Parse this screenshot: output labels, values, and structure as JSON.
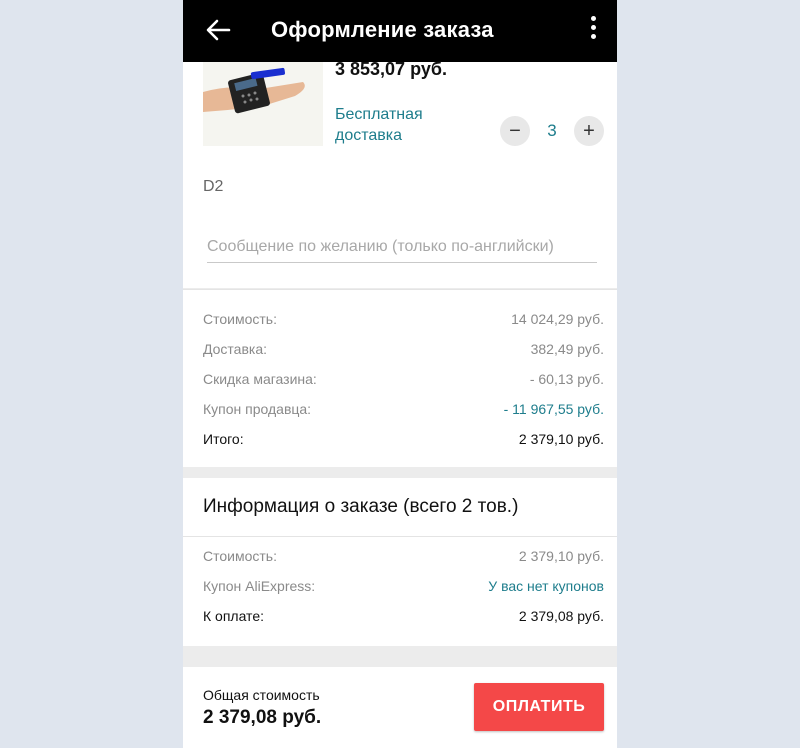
{
  "appbar": {
    "title": "Оформление заказа",
    "back_icon": "arrow-left-icon",
    "more_icon": "more-vertical-icon"
  },
  "product": {
    "price": "3 853,07 руб.",
    "shipping_line1": "Бесплатная",
    "shipping_line2": "доставка",
    "quantity": "3",
    "minus_label": "−",
    "plus_label": "+",
    "variant": "D2",
    "message_placeholder": "Сообщение по желанию (только по-английски)"
  },
  "summary": {
    "rows": [
      {
        "label": "Стоимость:",
        "value": "14 024,29 руб."
      },
      {
        "label": "Доставка:",
        "value": "382,49 руб."
      },
      {
        "label": "Скидка магазина:",
        "value": "- 60,13 руб."
      },
      {
        "label": "Купон продавца:",
        "value": "- 11 967,55 руб."
      },
      {
        "label": "Итого:",
        "value": "2 379,10 руб."
      }
    ]
  },
  "order_info": {
    "heading": "Информация о заказе (всего 2 тов.)",
    "rows": [
      {
        "label": "Стоимость:",
        "value": "2 379,10 руб."
      },
      {
        "label": "Купон AliExpress:",
        "value": "У вас нет купонов"
      },
      {
        "label": "К оплате:",
        "value": "2 379,08 руб."
      }
    ]
  },
  "bottom": {
    "caption": "Общая стоимость",
    "amount": "2 379,08 руб.",
    "pay_label": "ОПЛАТИТЬ"
  },
  "colors": {
    "accent": "#1e7d8c",
    "pay_button": "#f44848",
    "appbar": "#000000"
  }
}
